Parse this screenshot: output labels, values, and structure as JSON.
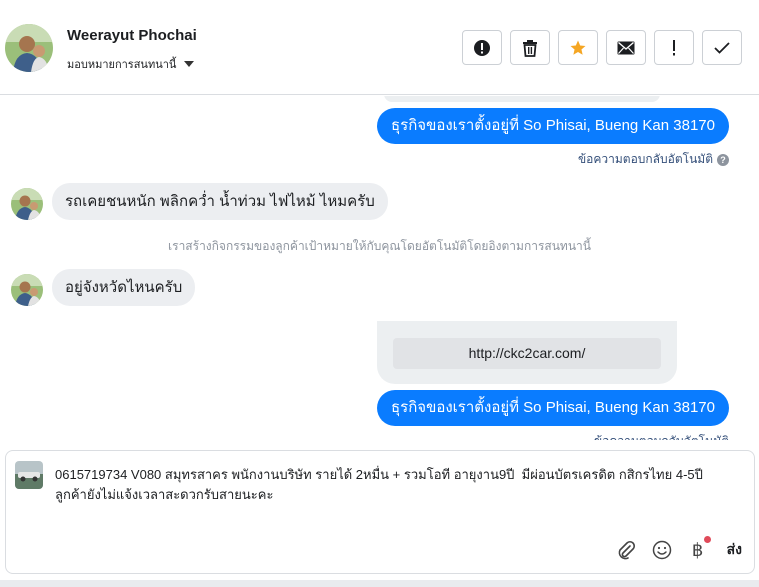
{
  "header": {
    "contact_name": "Weerayut Phochai",
    "assign_label": "มอบหมายการสนทนานี้",
    "actions": [
      {
        "name": "report-spam",
        "icon": "exclamation-circle-icon"
      },
      {
        "name": "delete",
        "icon": "trash-icon"
      },
      {
        "name": "star",
        "icon": "star-icon",
        "color": "#f5a623"
      },
      {
        "name": "mark-unread",
        "icon": "envelope-icon"
      },
      {
        "name": "follow-up",
        "icon": "exclamation-icon"
      },
      {
        "name": "mark-done",
        "icon": "check-icon"
      }
    ]
  },
  "messages": {
    "outgoing_1": "ธุรกิจของเราตั้งอยู่ที่ So Phisai, Bueng Kan 38170",
    "auto_reply_label": "ข้อความตอบกลับอัตโนมัติ",
    "help_glyph": "?",
    "incoming_1": "รถเคยชนหนัก พลิกคว่ำ น้ำท่วม ไฟไหม้ ไหมครับ",
    "system_note": "เราสร้างกิจกรรมของลูกค้าเป้าหมายให้กับคุณโดยอัตโนมัติโดยอิงตามการสนทนานี้",
    "incoming_2": "อยู่จังหวัดไหนครับ",
    "link_preview": "http://ckc2car.com/",
    "outgoing_2": "ธุรกิจของเราตั้งอยู่ที่ So Phisai, Bueng Kan 38170",
    "auto_reply_label_2": "ข้อความตอบกลับอัตโนมัติ"
  },
  "composer": {
    "text": "0615719734 V080 สมุทรสาคร พนักงานบริษัท รายได้ 2หมื่น + รวมโอที อายุงาน9ปี  มีผ่อนบัตรเครดิต กสิกรไทย 4-5ปี\nลูกค้ายังไม่แจ้งเวลาสะดวกรับสายนะคะ",
    "baht_glyph": "฿",
    "send_label": "ส่ง",
    "tools": [
      "paperclip-icon",
      "smiley-icon",
      "baht-icon"
    ]
  },
  "colors": {
    "outgoing_bubble": "#0a7cff",
    "incoming_bubble": "#eceef1",
    "star": "#f5a623",
    "notification_dot": "#e04b5a"
  }
}
